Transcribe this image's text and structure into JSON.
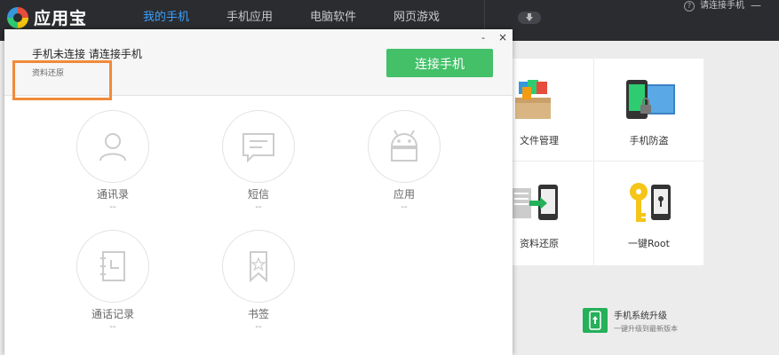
{
  "app": {
    "name": "应用宝"
  },
  "nav": {
    "items": [
      "我的手机",
      "手机应用",
      "电脑软件",
      "网页游戏"
    ]
  },
  "top_right": {
    "help_label": "请连接手机",
    "minimize": "—"
  },
  "tools": [
    {
      "label": "文件管理",
      "icon": "file-box-icon"
    },
    {
      "label": "手机防盗",
      "icon": "phone-lock-icon"
    },
    {
      "label": "资料还原",
      "icon": "restore-icon"
    },
    {
      "label": "一键Root",
      "icon": "key-icon"
    }
  ],
  "upgrade": {
    "title": "手机系统升级",
    "subtitle": "一键升级到最新版本"
  },
  "panel": {
    "title": "手机未连接 请连接手机",
    "subtitle": "资料还原",
    "connect_label": "连接手机",
    "minimize": "-",
    "close": "×",
    "items": [
      {
        "label": "通讯录",
        "count": "--",
        "icon": "contacts-icon"
      },
      {
        "label": "短信",
        "count": "--",
        "icon": "sms-icon"
      },
      {
        "label": "应用",
        "count": "--",
        "icon": "android-icon"
      },
      {
        "label": "通话记录",
        "count": "--",
        "icon": "call-log-icon"
      },
      {
        "label": "书签",
        "count": "--",
        "icon": "bookmark-icon"
      }
    ]
  },
  "colors": {
    "accent": "#3aa1ff",
    "connect_button": "#43c068",
    "highlight": "#f08a3a",
    "topbar": "#2a2c30"
  }
}
